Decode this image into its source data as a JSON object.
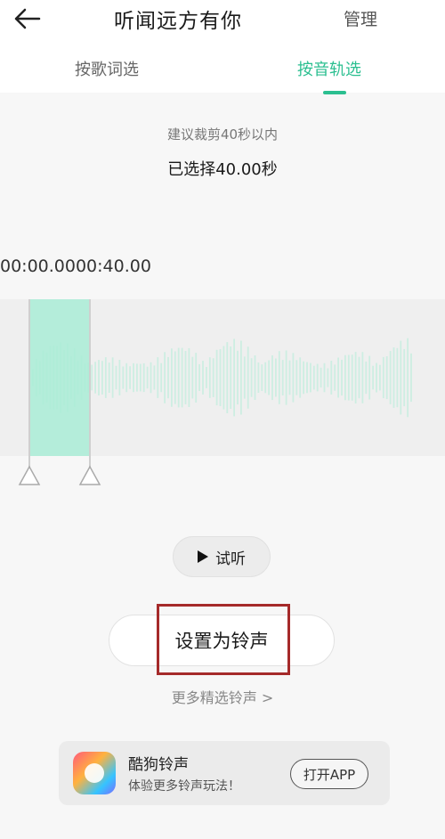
{
  "header": {
    "title": "听闻远方有你",
    "manage_label": "管理",
    "back_icon": "arrow-left-icon"
  },
  "tabs": [
    {
      "label": "按歌词选",
      "active": false
    },
    {
      "label": "按音轨选",
      "active": true
    }
  ],
  "accent_color": "#2bbf90",
  "clip": {
    "suggestion": "建议裁剪40秒以内",
    "selected_text": "已选择40.00秒",
    "time_readout": "00:00.0000:40.00"
  },
  "actions": {
    "preview_label": "试听",
    "set_ringtone_label": "设置为铃声",
    "more_link": "更多精选铃声 >"
  },
  "banner": {
    "app_name": "酷狗铃声",
    "description": "体验更多铃声玩法！",
    "open_label": "打开APP"
  }
}
